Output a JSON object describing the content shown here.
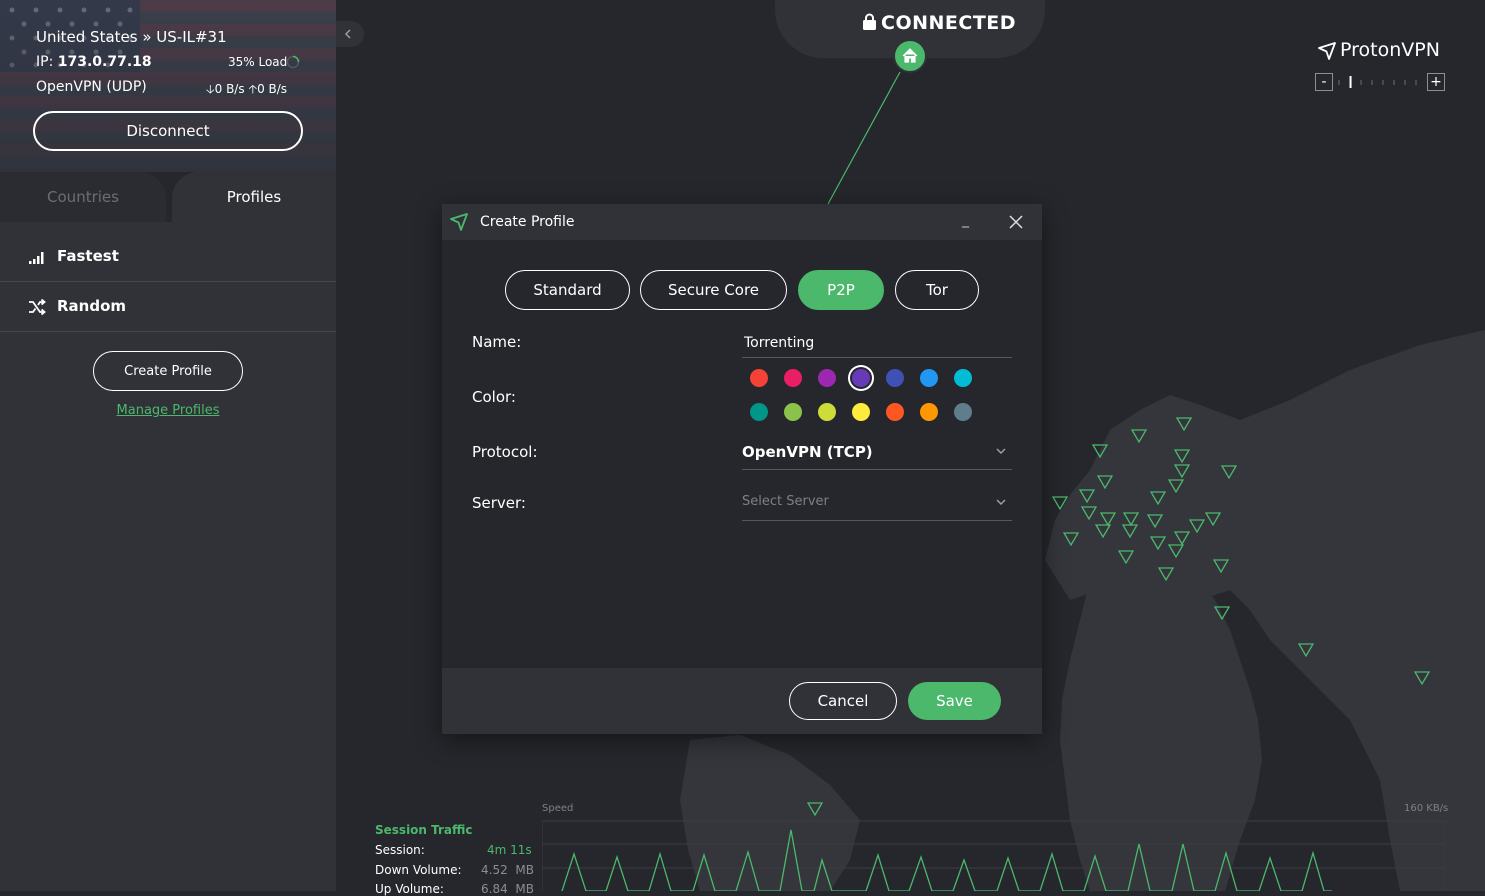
{
  "connection": {
    "location": "United States » US-IL#31",
    "ip_label": "IP:",
    "ip_value": "173.0.77.18",
    "load": "35% Load",
    "protocol": "OpenVPN (UDP)",
    "down_speed": "0 B/s",
    "up_speed": "0 B/s",
    "disconnect_label": "Disconnect",
    "status": "CONNECTED"
  },
  "sidebar": {
    "tabs": [
      "Countries",
      "Profiles"
    ],
    "active_tab": "Profiles",
    "items": [
      {
        "label": "Fastest",
        "icon": "signal-bars-icon"
      },
      {
        "label": "Random",
        "icon": "shuffle-icon"
      }
    ],
    "create_profile_label": "Create Profile",
    "manage_profiles_label": "Manage Profiles"
  },
  "brand": {
    "name": "ProtonVPN",
    "zoom_out": "-",
    "zoom_in": "+",
    "zoom_level": 0.15
  },
  "dialog": {
    "title": "Create Profile",
    "minimize": "_",
    "close_icon": "close-icon",
    "types": [
      "Standard",
      "Secure Core",
      "P2P",
      "Tor"
    ],
    "active_type": "P2P",
    "fields": {
      "name_label": "Name:",
      "name_value": "Torrenting",
      "color_label": "Color:",
      "protocol_label": "Protocol:",
      "protocol_value": "OpenVPN (TCP)",
      "server_label": "Server:",
      "server_placeholder": "Select Server"
    },
    "colors": [
      "#f44336",
      "#e91e63",
      "#9c27b0",
      "#673ab7",
      "#3f51b5",
      "#2196f3",
      "#00bcd4",
      "#009688",
      "#8bc34a",
      "#cddc39",
      "#ffeb3b",
      "#ff5722",
      "#ff9800",
      "#607d8b"
    ],
    "selected_color": "#673ab7",
    "cancel_label": "Cancel",
    "save_label": "Save"
  },
  "stats": {
    "title": "Session Traffic",
    "session_label": "Session:",
    "session_value": "4m 11s",
    "down_label": "Down Volume:",
    "down_value": "4.52",
    "down_unit": "MB",
    "up_label": "Up Volume:",
    "up_value": "6.84",
    "up_unit": "MB",
    "speed_label": "Speed",
    "speed_max": "160  KB/s"
  },
  "colors": {
    "accent": "#4bb86c",
    "background": "#25272c",
    "panel": "#303238",
    "map_land": "#34363c"
  }
}
